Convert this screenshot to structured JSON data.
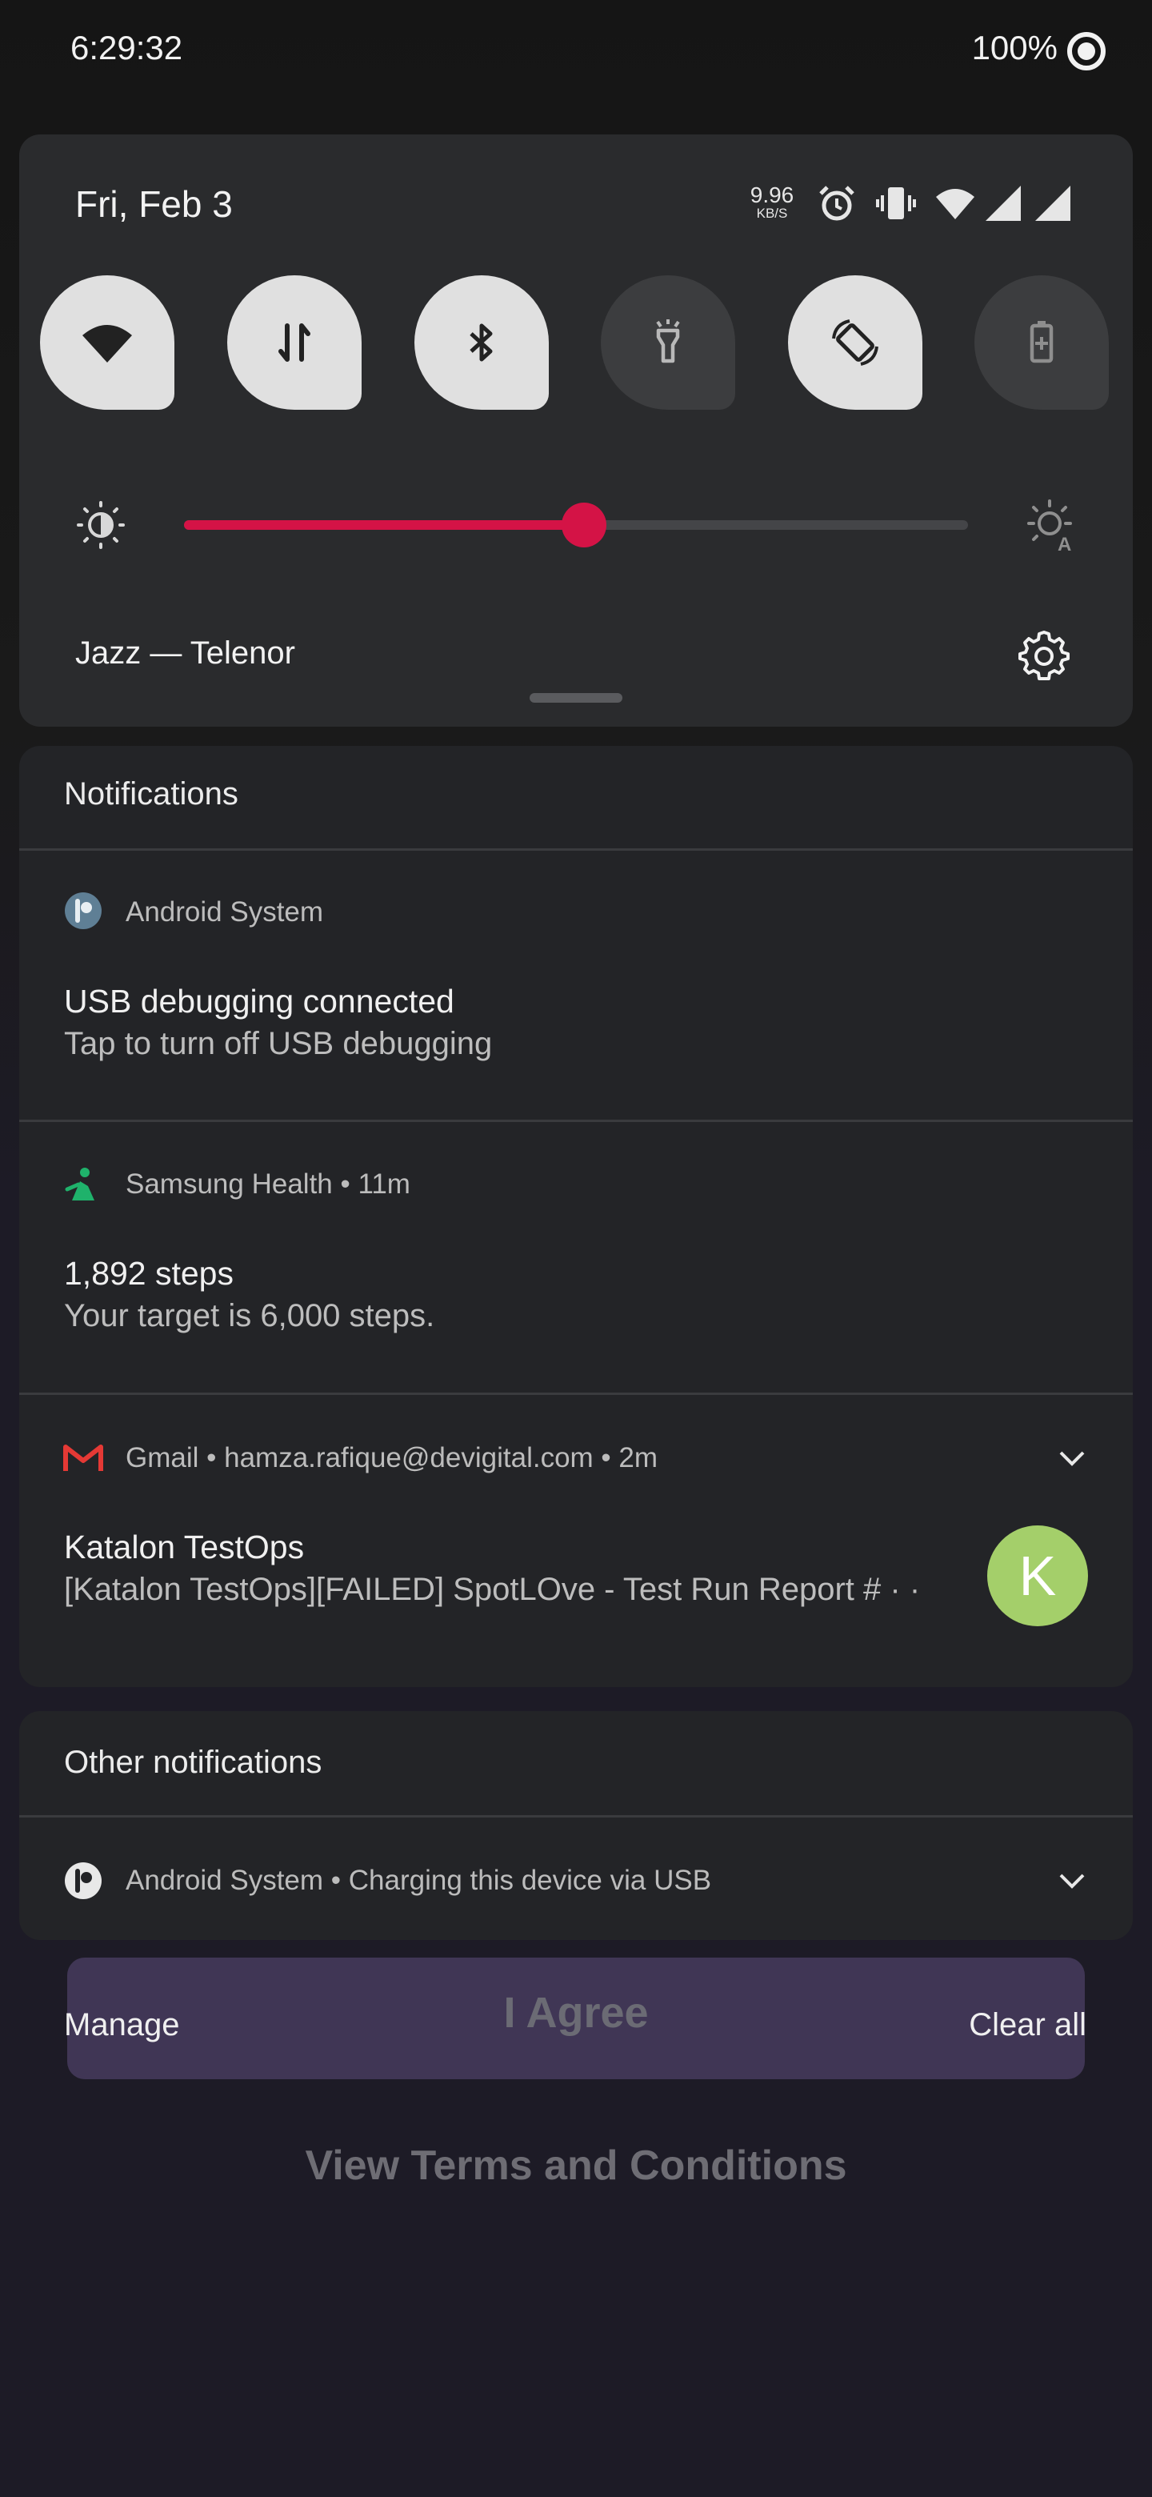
{
  "status_bar": {
    "time": "6:29:32",
    "battery": "100%",
    "net_speed_value": "9.96",
    "net_speed_unit": "KB/S",
    "icons": [
      "alarm-icon",
      "vibrate-icon",
      "wifi-icon",
      "cell-signal-icon",
      "cell-signal-icon"
    ]
  },
  "quick_settings": {
    "date": "Fri, Feb 3",
    "tiles": [
      {
        "name": "wifi",
        "icon": "wifi-icon",
        "active": true
      },
      {
        "name": "mobile-data",
        "icon": "data-arrows-icon",
        "active": true
      },
      {
        "name": "bluetooth",
        "icon": "bluetooth-icon",
        "active": true
      },
      {
        "name": "flashlight",
        "icon": "flashlight-icon",
        "active": false
      },
      {
        "name": "auto-rotate",
        "icon": "rotate-icon",
        "active": true
      },
      {
        "name": "battery-saver",
        "icon": "battery-saver-icon",
        "active": false
      }
    ],
    "brightness_level": 0.51,
    "carrier": "Jazz — Telenor",
    "accent_color": "#d41346"
  },
  "notifications": {
    "section_title": "Notifications",
    "items": [
      {
        "app": "Android System",
        "icon": "android-system-icon",
        "title": "USB debugging connected",
        "text": "Tap to turn off USB debugging"
      },
      {
        "app": "Samsung Health",
        "time": "11m",
        "icon": "samsung-health-icon",
        "title": "1,892 steps",
        "text": "Your target is 6,000 steps."
      },
      {
        "app": "Gmail",
        "account": "hamza.rafique@devigital.com",
        "time": "2m",
        "icon": "gmail-icon",
        "title": "Katalon TestOps",
        "text": "[Katalon TestOps][FAILED] SpotLOve - Test Run Report # · ·",
        "avatar_letter": "K",
        "avatar_color": "#a4cf6a"
      }
    ]
  },
  "other_notifications": {
    "section_title": "Other notifications",
    "item": {
      "app": "Android System",
      "text": "Charging this device via USB",
      "icon": "android-system-icon"
    }
  },
  "actions": {
    "manage": "Manage",
    "clear_all": "Clear all"
  },
  "background_app": {
    "agree_button": "I Agree",
    "terms_link": "View Terms and Conditions"
  }
}
